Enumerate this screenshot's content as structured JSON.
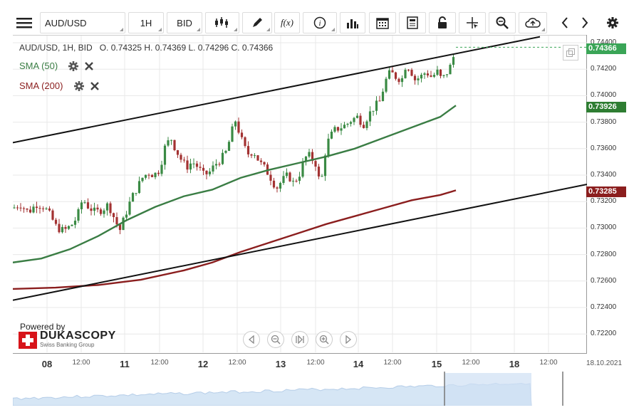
{
  "toolbar": {
    "symbol": "AUD/USD",
    "timeframe": "1H",
    "price_side": "BID",
    "function_label": "f(x)"
  },
  "instrument": {
    "header": "AUD/USD, 1H, BID",
    "ohlc": "O. 0.74325 H. 0.74369 L. 0.74296 C. 0.74366"
  },
  "legend": [
    {
      "label": "SMA (50)",
      "color": "#3a7d44"
    },
    {
      "label": "SMA (200)",
      "color": "#8b1e1e"
    }
  ],
  "chart_data": {
    "type": "candlestick",
    "y_ticks": [
      "0.74400",
      "0.74200",
      "0.74000",
      "0.73800",
      "0.73600",
      "0.73400",
      "0.73200",
      "0.73000",
      "0.72800",
      "0.72600",
      "0.72400",
      "0.72200"
    ],
    "x_ticks": [
      "08",
      "12:00",
      "11",
      "12:00",
      "12",
      "12:00",
      "13",
      "12:00",
      "14",
      "12:00",
      "15",
      "12:00",
      "18",
      "12:00",
      "18.10.2021"
    ],
    "price_tags": [
      {
        "value": "0.74366",
        "color": "#3aa557"
      },
      {
        "value": "0.73926",
        "color": "#2e7d32"
      },
      {
        "value": "0.73285",
        "color": "#8b1e1e"
      }
    ]
  },
  "branding": {
    "powered_by": "Powered by",
    "brand": "DUKASCOPY",
    "tagline": "Swiss Banking Group"
  },
  "colors": {
    "bull": "#3a8a44",
    "bear": "#a33232",
    "sma50": "#3a7d44",
    "sma200": "#8b1e1e",
    "channel": "#111111",
    "grid": "#e8e8e8"
  }
}
